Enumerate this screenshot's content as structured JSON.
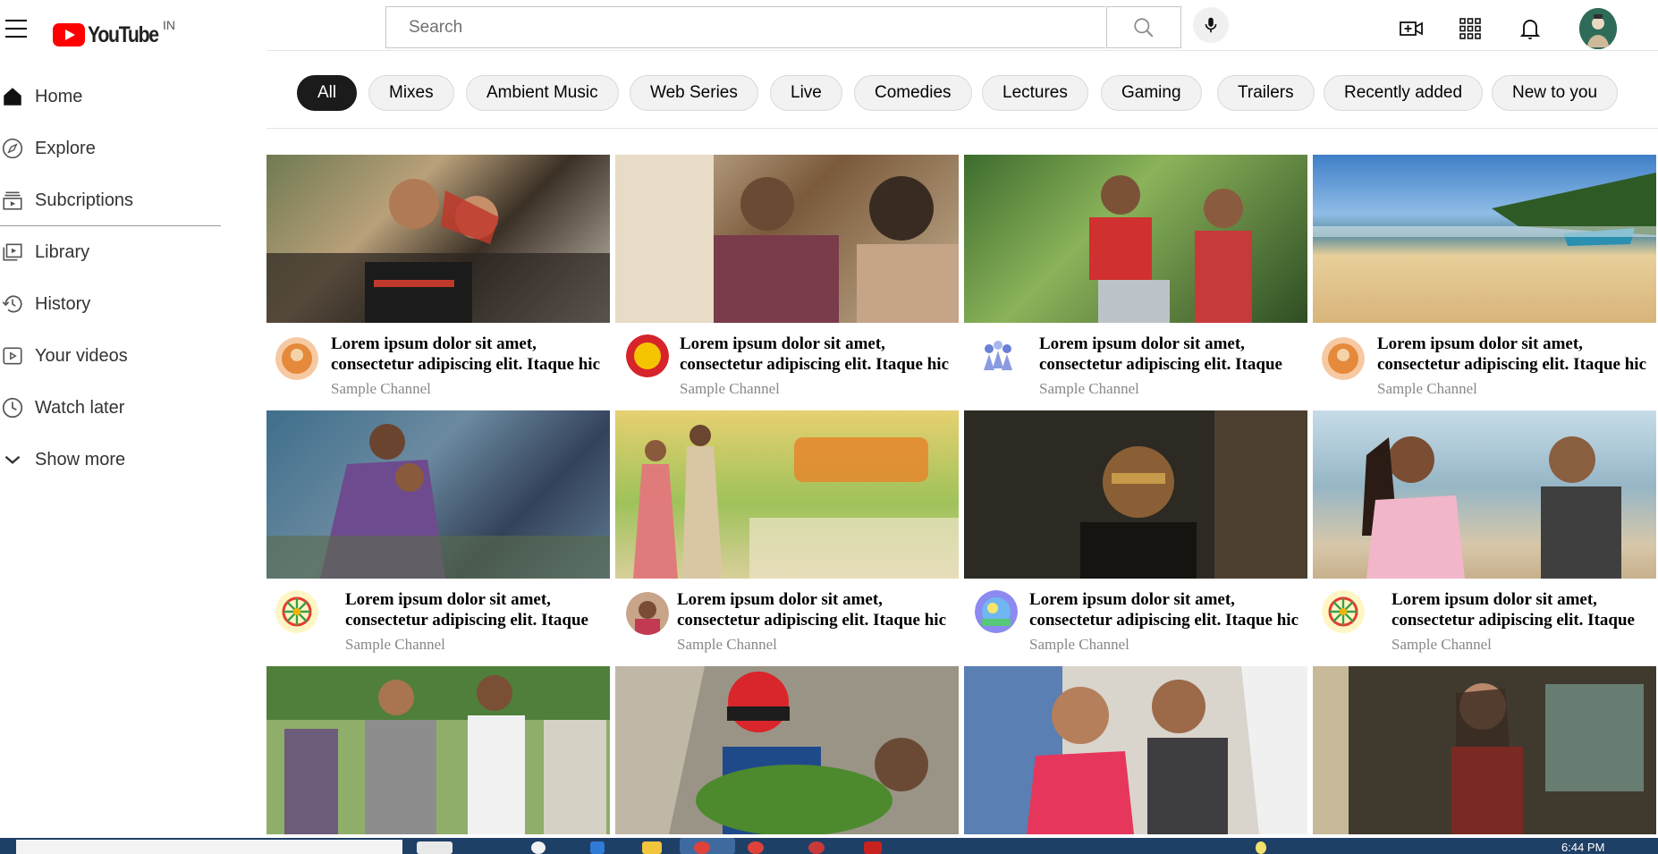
{
  "header": {
    "logo_text": "YouTube",
    "country_code": "IN",
    "search_placeholder": "Search",
    "icons": [
      "menu-icon",
      "search-icon",
      "mic-icon",
      "create-video-icon",
      "apps-grid-icon",
      "bell-icon"
    ]
  },
  "sidebar": {
    "items": [
      {
        "label": "Home",
        "icon": "home-icon"
      },
      {
        "label": "Explore",
        "icon": "compass-icon"
      },
      {
        "label": "Subcriptions",
        "icon": "subscriptions-icon"
      },
      {
        "label": "Library",
        "icon": "library-icon"
      },
      {
        "label": "History",
        "icon": "history-icon"
      },
      {
        "label": "Your videos",
        "icon": "your-videos-icon"
      },
      {
        "label": "Watch later",
        "icon": "clock-icon"
      },
      {
        "label": "Show more",
        "icon": "chevron-down-icon"
      }
    ]
  },
  "chips": [
    "All",
    "Mixes",
    "Ambient Music",
    "Web Series",
    "Live",
    "Comedies",
    "Lectures",
    "Gaming",
    "Trailers",
    "Recently added",
    "New to you"
  ],
  "active_chip": "All",
  "videos": [
    {
      "title_line1": "Lorem ipsum dolor sit amet,",
      "title_line2": "consectetur adipiscing elit. Itaque hic",
      "channel": "Sample Channel"
    },
    {
      "title_line1": "Lorem ipsum dolor sit amet,",
      "title_line2": "consectetur adipiscing elit. Itaque hic",
      "channel": "Sample Channel"
    },
    {
      "title_line1": "Lorem ipsum dolor sit amet,",
      "title_line2": "consectetur adipiscing elit. Itaque",
      "channel": "Sample Channel"
    },
    {
      "title_line1": "Lorem ipsum dolor sit amet,",
      "title_line2": "consectetur adipiscing elit. Itaque hic",
      "channel": "Sample Channel"
    },
    {
      "title_line1": "Lorem ipsum dolor sit amet,",
      "title_line2": "consectetur adipiscing elit. Itaque",
      "channel": "Sample Channel"
    },
    {
      "title_line1": "Lorem ipsum dolor sit amet,",
      "title_line2": "consectetur adipiscing elit. Itaque hic",
      "channel": "Sample Channel"
    },
    {
      "title_line1": "Lorem ipsum dolor sit amet,",
      "title_line2": "consectetur adipiscing elit. Itaque hic",
      "channel": "Sample Channel"
    },
    {
      "title_line1": "Lorem ipsum dolor sit amet,",
      "title_line2": "consectetur adipiscing elit. Itaque",
      "channel": "Sample Channel"
    }
  ],
  "taskbar": {
    "time": "6:44 PM"
  },
  "colors": {
    "brand": "#ff0000",
    "chip_active": "#1b1b1b",
    "chip_bg": "#f2f2f2",
    "taskbar": "#1e3f66"
  }
}
